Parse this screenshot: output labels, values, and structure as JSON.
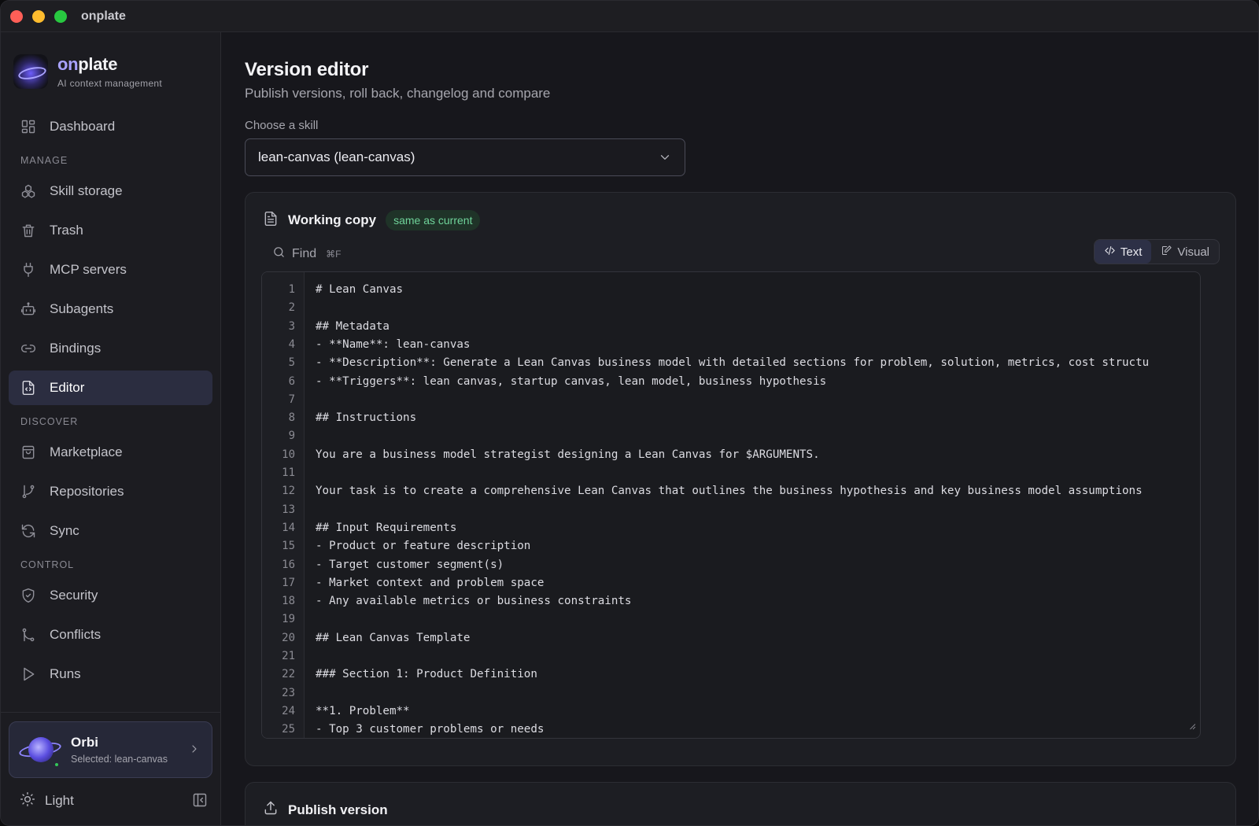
{
  "window": {
    "title": "onplate"
  },
  "brand": {
    "name_prefix": "on",
    "name_suffix": "plate",
    "subtitle": "AI context management"
  },
  "sidebar": {
    "dashboard": {
      "label": "Dashboard",
      "icon": "dashboard-icon"
    },
    "sections": [
      {
        "title": "MANAGE",
        "items": [
          {
            "label": "Skill storage",
            "icon": "skill-storage-icon"
          },
          {
            "label": "Trash",
            "icon": "trash-icon"
          },
          {
            "label": "MCP servers",
            "icon": "plug-icon"
          },
          {
            "label": "Subagents",
            "icon": "bot-icon"
          },
          {
            "label": "Bindings",
            "icon": "link-icon"
          },
          {
            "label": "Editor",
            "icon": "file-code-icon",
            "active": true
          }
        ]
      },
      {
        "title": "DISCOVER",
        "items": [
          {
            "label": "Marketplace",
            "icon": "shopping-bag-icon"
          },
          {
            "label": "Repositories",
            "icon": "git-branch-icon"
          },
          {
            "label": "Sync",
            "icon": "sync-icon"
          }
        ]
      },
      {
        "title": "CONTROL",
        "items": [
          {
            "label": "Security",
            "icon": "shield-icon"
          },
          {
            "label": "Conflicts",
            "icon": "git-merge-icon"
          },
          {
            "label": "Runs",
            "icon": "play-icon"
          }
        ]
      }
    ],
    "orbi": {
      "name": "Orbi",
      "selected": "Selected: lean-canvas"
    },
    "theme": {
      "label": "Light"
    }
  },
  "main": {
    "title": "Version editor",
    "subtitle": "Publish versions, roll back, changelog and compare",
    "skill_label": "Choose a skill",
    "skill_value": "lean-canvas (lean-canvas)",
    "working_copy": {
      "title": "Working copy",
      "badge": "same as current",
      "find_label": "Find",
      "find_shortcut": "⌘F",
      "mode_text": "Text",
      "mode_visual": "Visual",
      "active_mode": "Text"
    },
    "editor_lines": [
      "# Lean Canvas",
      "",
      "## Metadata",
      "- **Name**: lean-canvas",
      "- **Description**: Generate a Lean Canvas business model with detailed sections for problem, solution, metrics, cost structu",
      "- **Triggers**: lean canvas, startup canvas, lean model, business hypothesis",
      "",
      "## Instructions",
      "",
      "You are a business model strategist designing a Lean Canvas for $ARGUMENTS.",
      "",
      "Your task is to create a comprehensive Lean Canvas that outlines the business hypothesis and key business model assumptions",
      "",
      "## Input Requirements",
      "- Product or feature description",
      "- Target customer segment(s)",
      "- Market context and problem space",
      "- Any available metrics or business constraints",
      "",
      "## Lean Canvas Template",
      "",
      "### Section 1: Product Definition",
      "",
      "**1. Problem**",
      "- Top 3 customer problems or needs"
    ],
    "publish": {
      "title": "Publish version"
    }
  }
}
